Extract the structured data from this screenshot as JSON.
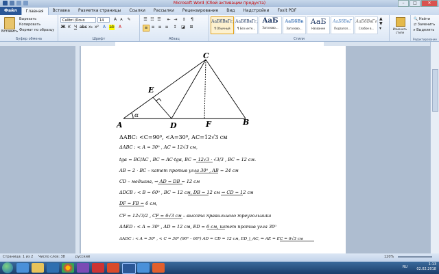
{
  "window": {
    "title": "Microsoft Word (Сбой активации продукта)"
  },
  "tabs": [
    "Файл",
    "Главная",
    "Вставка",
    "Разметка страницы",
    "Ссылки",
    "Рассылки",
    "Рецензирование",
    "Вид",
    "Надстройки",
    "Foxit PDF"
  ],
  "ribbon": {
    "clipboard": {
      "paste": "Вставить",
      "cut": "Вырезать",
      "copy": "Копировать",
      "format": "Формат по образцу",
      "label": "Буфер обмена"
    },
    "font": {
      "name": "Calibri (Осно",
      "size": "14",
      "label": "Шрифт"
    },
    "paragraph": {
      "label": "Абзац"
    },
    "styles": {
      "label": "Стили",
      "items": [
        {
          "sample": "АаБбВвГг,",
          "name": "¶ Обычный"
        },
        {
          "sample": "АаБбВвГг,",
          "name": "¶ Без инте..."
        },
        {
          "sample": "АаБ",
          "name": "Заголово..."
        },
        {
          "sample": "АаБбВв",
          "name": "Заголово..."
        },
        {
          "sample": "АаБ",
          "name": "Название"
        },
        {
          "sample": "АаБбВвГ",
          "name": "Подзагол..."
        },
        {
          "sample": "АаБбВвГг",
          "name": "Слабое в..."
        }
      ],
      "change": "Изменить стили"
    },
    "editing": {
      "find": "Найти",
      "replace": "Заменить",
      "select": "Выделить",
      "label": "Редактирование"
    }
  },
  "document": {
    "labels": {
      "A": "A",
      "B": "B",
      "C": "C",
      "D": "D",
      "E": "E",
      "F": "F",
      "alpha": "α"
    },
    "lines": [
      "ΔАВС: <С=90⁰, <А=30⁰, АС=12√3 см",
      "ΔАВС : < А = 30⁰ , АС = 12√3 см,",
      "tgα = BC/AC ,  BC = AC·tgα,    BC = 12√3 · √3/3 ,   BC = 12 см.",
      "AB = 2 · BC – катет против угла 30⁰ ,    AB = 24 см",
      "CD – медиана, ⇒ AD = DB = 12 см",
      "ΔDCB : < B = 60⁰ , BC = 12 см, DB = 12 см ⇒ CD = 12 см",
      "DF = FB = 6 см,",
      "CF = 12√3/2 ,   CF = 6√3 см – высота правильного треугольника",
      "ΔAED : < A = 30⁰ , AD = 12 см, ED = 6 см, катет против угла 30⁰",
      "ΔADC : < A = 30⁰ , < C = 30⁰ (90⁰ – 60⁰) AD = CD = 12 см,  ED_|_AC, ⇒   AE = EC = 6√3 см"
    ]
  },
  "statusbar": {
    "page": "Страница: 1 из 2",
    "words": "Число слов: 38",
    "lang": "русский",
    "zoom": "120%"
  },
  "taskbar": {
    "lang": "RU",
    "time": "1:13",
    "date": "02.02.2018"
  }
}
